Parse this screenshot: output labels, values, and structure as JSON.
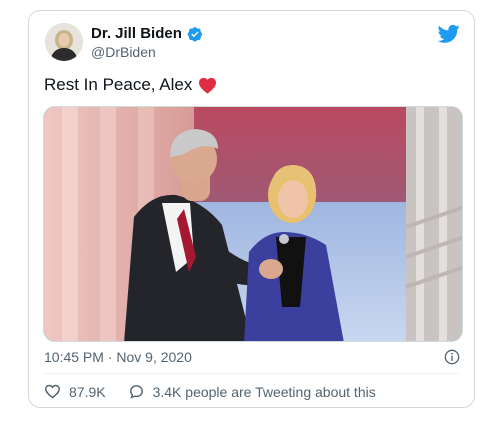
{
  "author": {
    "display_name": "Dr. Jill Biden",
    "handle": "@DrBiden",
    "verified": true,
    "avatar_icon": "profile-photo"
  },
  "tweet": {
    "text": "Rest In Peace, Alex",
    "emoji_icon": "red-heart-icon",
    "media_description_icon": "photo"
  },
  "meta": {
    "timestamp": "10:45 PM · Nov 9, 2020"
  },
  "actions": {
    "likes": "87.9K",
    "conversation": "3.4K people are Tweeting about this"
  },
  "colors": {
    "twitter_blue": "#1d9bf0",
    "heart_red": "#e0245e",
    "secondary_text": "#536471",
    "border": "#cfd9de"
  }
}
